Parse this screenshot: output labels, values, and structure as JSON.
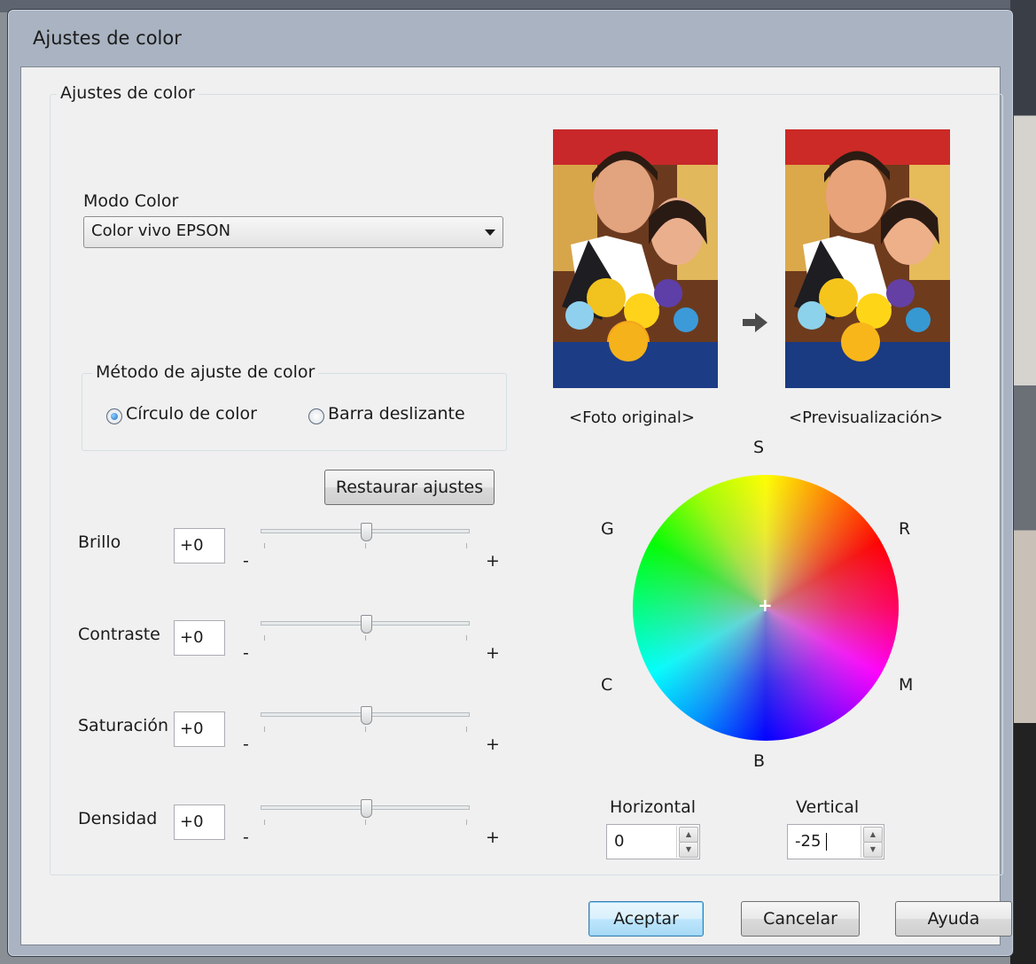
{
  "window": {
    "title": "Ajustes de color"
  },
  "group_main": {
    "legend": "Ajustes de color"
  },
  "color_mode": {
    "label": "Modo Color",
    "selected": "Color vivo EPSON"
  },
  "method": {
    "legend": "Método de ajuste de color",
    "options": [
      {
        "label": "Círculo de color",
        "checked": true
      },
      {
        "label": "Barra deslizante",
        "checked": false
      }
    ]
  },
  "restore_button": "Restaurar ajustes",
  "sliders": [
    {
      "label": "Brillo",
      "value": "+0",
      "min_label": "-",
      "max_label": "+",
      "position": 0.5
    },
    {
      "label": "Contraste",
      "value": "+0",
      "min_label": "-",
      "max_label": "+",
      "position": 0.5
    },
    {
      "label": "Saturación",
      "value": "+0",
      "min_label": "-",
      "max_label": "+",
      "position": 0.5
    },
    {
      "label": "Densidad",
      "value": "+0",
      "min_label": "-",
      "max_label": "+",
      "position": 0.5
    }
  ],
  "preview": {
    "original_caption": "<Foto original>",
    "preview_caption": "<Previsualización>"
  },
  "color_wheel": {
    "labels": {
      "top": "S",
      "bottom": "B",
      "upper_left": "G",
      "upper_right": "R",
      "lower_left": "C",
      "lower_right": "M"
    }
  },
  "horizontal": {
    "label": "Horizontal",
    "value": "0"
  },
  "vertical": {
    "label": "Vertical",
    "value": "-25"
  },
  "buttons": {
    "ok": "Aceptar",
    "cancel": "Cancelar",
    "help": "Ayuda"
  }
}
